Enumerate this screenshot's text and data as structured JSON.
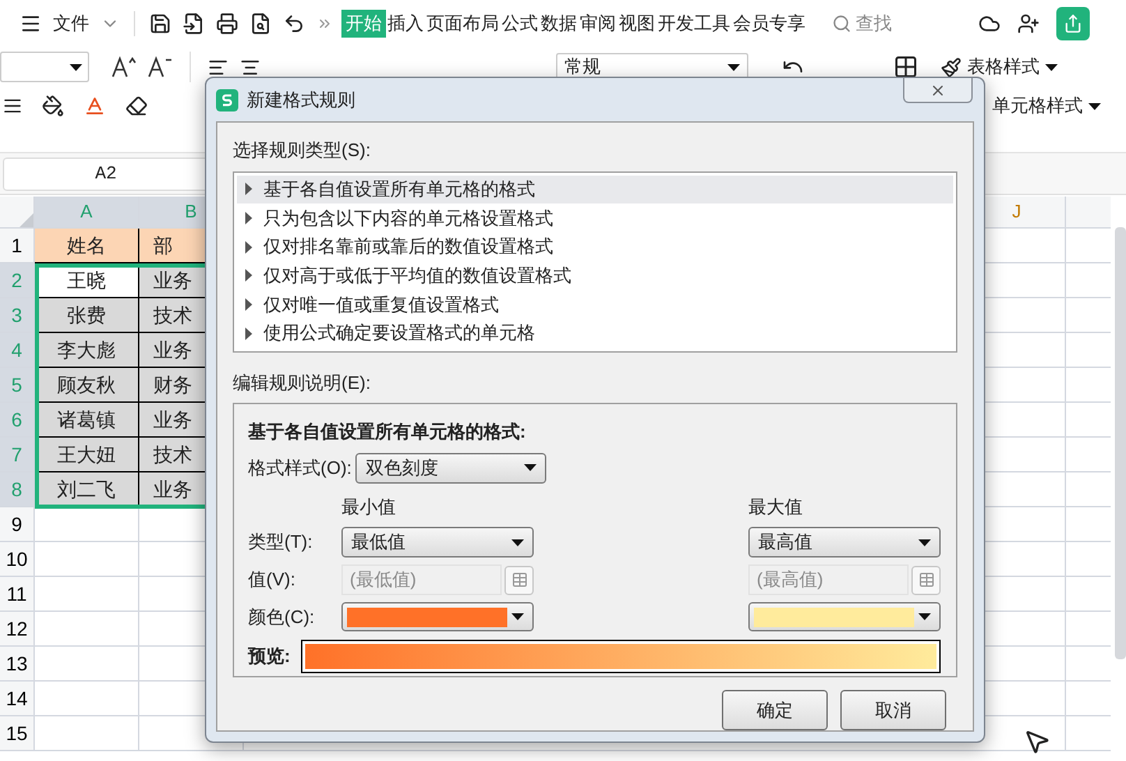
{
  "app": {
    "file_menu": "文件",
    "tabs": [
      {
        "label": "开始",
        "selected": true
      },
      {
        "label": "插入",
        "selected": false
      },
      {
        "label": "页面布局",
        "selected": false
      },
      {
        "label": "公式",
        "selected": false
      },
      {
        "label": "数据",
        "selected": false
      },
      {
        "label": "审阅",
        "selected": false
      },
      {
        "label": "视图",
        "selected": false
      },
      {
        "label": "开发工具",
        "selected": false
      },
      {
        "label": "会员专享",
        "selected": false
      }
    ],
    "search": {
      "placeholder": "查找"
    }
  },
  "ribbon": {
    "number_format": "常规",
    "style_buttons": [
      "表格样式",
      "单元格样式"
    ]
  },
  "name_box": "A2",
  "sheet": {
    "columns": [
      {
        "label": "A",
        "selected": true
      },
      {
        "label": "B",
        "selected": true
      },
      {
        "label": "J",
        "selected": false
      }
    ],
    "rows": [
      {
        "number": "1",
        "kind": "header",
        "selected": false,
        "cells": [
          "姓名",
          "部"
        ]
      },
      {
        "number": "2",
        "kind": "data",
        "selected": true,
        "active": true,
        "cells": [
          "王晓",
          "业务"
        ]
      },
      {
        "number": "3",
        "kind": "data",
        "selected": true,
        "active": false,
        "cells": [
          "张费",
          "技术"
        ]
      },
      {
        "number": "4",
        "kind": "data",
        "selected": true,
        "active": false,
        "cells": [
          "李大彪",
          "业务"
        ]
      },
      {
        "number": "5",
        "kind": "data",
        "selected": true,
        "active": false,
        "cells": [
          "顾友秋",
          "财务"
        ]
      },
      {
        "number": "6",
        "kind": "data",
        "selected": true,
        "active": false,
        "cells": [
          "诸葛镇",
          "业务"
        ]
      },
      {
        "number": "7",
        "kind": "data",
        "selected": true,
        "active": false,
        "cells": [
          "王大妞",
          "技术"
        ]
      },
      {
        "number": "8",
        "kind": "data",
        "selected": true,
        "active": false,
        "cells": [
          "刘二飞",
          "业务"
        ]
      },
      {
        "number": "9",
        "kind": "empty",
        "selected": false,
        "cells": []
      },
      {
        "number": "10",
        "kind": "empty",
        "selected": false,
        "cells": []
      },
      {
        "number": "11",
        "kind": "empty",
        "selected": false,
        "cells": []
      },
      {
        "number": "12",
        "kind": "empty",
        "selected": false,
        "cells": []
      },
      {
        "number": "13",
        "kind": "empty",
        "selected": false,
        "cells": []
      },
      {
        "number": "14",
        "kind": "empty",
        "selected": false,
        "cells": []
      },
      {
        "number": "15",
        "kind": "empty",
        "selected": false,
        "cells": []
      }
    ]
  },
  "dialog": {
    "title": "新建格式规则",
    "rule_type_label": "选择规则类型(S):",
    "rule_types": [
      {
        "label": "基于各自值设置所有单元格的格式",
        "selected": true
      },
      {
        "label": "只为包含以下内容的单元格设置格式",
        "selected": false
      },
      {
        "label": "仅对排名靠前或靠后的数值设置格式",
        "selected": false
      },
      {
        "label": "仅对高于或低于平均值的数值设置格式",
        "selected": false
      },
      {
        "label": "仅对唯一值或重复值设置格式",
        "selected": false
      },
      {
        "label": "使用公式确定要设置格式的单元格",
        "selected": false
      }
    ],
    "edit_label": "编辑规则说明(E):",
    "description_title": "基于各自值设置所有单元格的格式:",
    "format_style_label": "格式样式(O):",
    "format_style": "双色刻度",
    "type_label": "类型(T):",
    "value_label": "值(V):",
    "color_label": "颜色(C):",
    "preview_label": "预览:",
    "min": {
      "heading": "最小值",
      "type": "最低值",
      "value": "(最低值)",
      "disabled": true,
      "color": "#ff7128"
    },
    "max": {
      "heading": "最大值",
      "type": "最高值",
      "value": "(最高值)",
      "disabled": true,
      "color": "#ffeb9c"
    },
    "buttons": [
      "确定",
      "取消"
    ]
  }
}
